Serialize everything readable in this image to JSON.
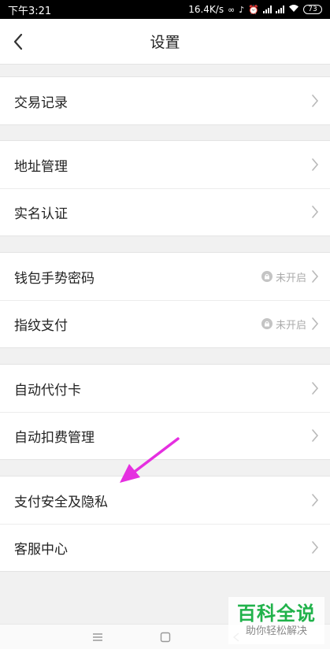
{
  "status_bar": {
    "time": "下午3:21",
    "network_speed": "16.4K/s",
    "battery": "73"
  },
  "header": {
    "title": "设置"
  },
  "groups": [
    {
      "items": [
        {
          "label": "交易记录"
        }
      ]
    },
    {
      "items": [
        {
          "label": "地址管理"
        },
        {
          "label": "实名认证"
        }
      ]
    },
    {
      "items": [
        {
          "label": "钱包手势密码",
          "status": "未开启"
        },
        {
          "label": "指纹支付",
          "status": "未开启"
        }
      ]
    },
    {
      "items": [
        {
          "label": "自动代付卡"
        },
        {
          "label": "自动扣费管理"
        }
      ]
    },
    {
      "items": [
        {
          "label": "支付安全及隐私"
        },
        {
          "label": "客服中心"
        }
      ]
    }
  ],
  "annotation": {
    "color": "#e52fe0",
    "points_to": "支付安全及隐私"
  },
  "watermark": {
    "title": "百科全说",
    "subtitle": "助你轻松解决",
    "color": "#20b24a"
  },
  "icons": {
    "back": "chevron-left-icon",
    "row_arrow": "chevron-right-icon",
    "status": "lock-icon"
  }
}
